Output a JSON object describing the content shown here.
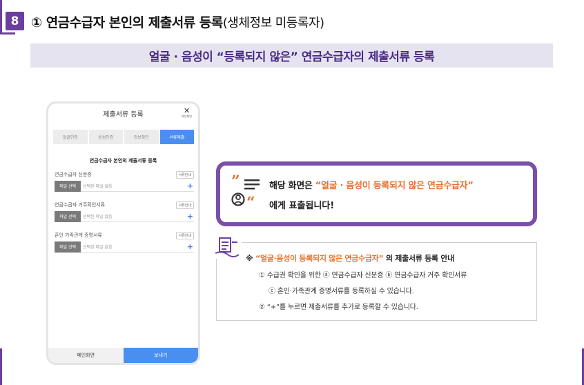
{
  "header": {
    "step_number": "8",
    "title_main": "① 연금수급자 본인의 제출서류 등록",
    "title_sub": "(생체정보 미등록자)"
  },
  "banner": {
    "text": "얼굴 · 음성이 “등록되지 않은” 연금수급자의 제출서류 등록"
  },
  "phone": {
    "title": "제출서류 등록",
    "close_label": "메인화면",
    "steps": [
      {
        "label": "얼굴인증",
        "active": false
      },
      {
        "label": "음성인증",
        "active": false
      },
      {
        "label": "정보확인",
        "active": false
      },
      {
        "label": "서류제출",
        "active": true
      }
    ],
    "section_title": "연금수급자 본인의 제출서류 등록",
    "fields": [
      {
        "name": "연금수급자 신분증",
        "guide": "서류안내",
        "pick": "파일 선택",
        "status": "선택된 파일 없음"
      },
      {
        "name": "연금수급자 거주확인서류",
        "guide": "서류안내",
        "pick": "파일 선택",
        "status": "선택된 파일 없음"
      },
      {
        "name": "혼인·가족관계 증명서류",
        "guide": "서류안내",
        "pick": "파일 선택",
        "status": "선택된 파일 없음"
      }
    ],
    "bottom_left": "메인화면",
    "bottom_right": "보내기"
  },
  "callout": {
    "prefix": "해당 화면은 ",
    "highlight": "“얼굴 · 음성이 등록되지 않은 연금수급자”",
    "line2": "에게 표출됩니다!"
  },
  "note": {
    "title_prefix": "※ ",
    "title_highlight": "“얼굴·음성이 등록되지 않은 연금수급자”",
    "title_suffix": " 의 제출서류 등록 안내",
    "item1_a": "① 수급권 확인을 위한 ⓐ 연금수급자 신분증 ⓑ 연금수급자 거주 확인서류",
    "item1_b": "ⓒ 혼인·가족관계 증명서류를 등록하실 수 있습니다.",
    "item2": "② “+”를 누르면 제출서류를 추가로 등록할 수 있습니다."
  },
  "colors": {
    "accent_purple": "#6b3fa0",
    "banner_bg": "#e6e3f0",
    "highlight_orange": "#e8712c",
    "phone_blue": "#4a8ff0"
  }
}
